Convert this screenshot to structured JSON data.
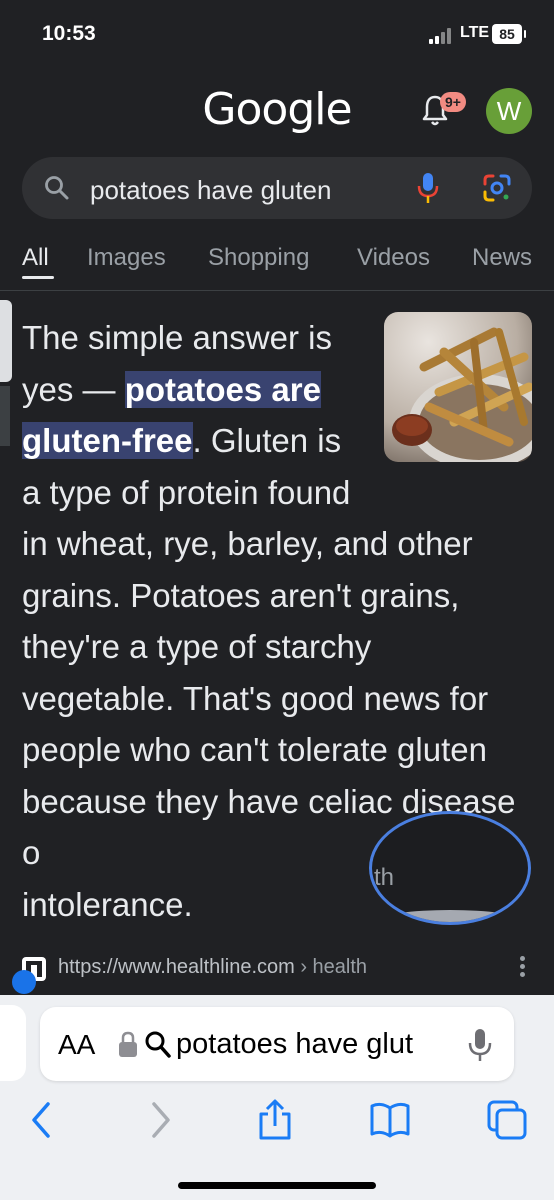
{
  "status_bar": {
    "time": "10:53",
    "network": "LTE",
    "battery": "85"
  },
  "header": {
    "logo": "Google",
    "notifications_badge": "9+",
    "avatar_initial": "W"
  },
  "search": {
    "query": "potatoes have gluten"
  },
  "tabs": [
    {
      "label": "All",
      "active": true
    },
    {
      "label": "Images",
      "active": false
    },
    {
      "label": "Shopping",
      "active": false
    },
    {
      "label": "Videos",
      "active": false
    },
    {
      "label": "News",
      "active": false
    }
  ],
  "answer": {
    "pre": "The simple answer is yes — ",
    "highlight": "potatoes are gluten-free",
    "post": ". Gluten is a type of protein found in wheat, rye, barley, and other grains. Potatoes aren't grains, they're a type of starchy vegetable. That's good news for people who can't tolerate gluten because they have celiac disease o",
    "end": "intolerance.",
    "ring_fragment": "th"
  },
  "source": {
    "url": "https://www.healthline.com",
    "path": "› health"
  },
  "safari": {
    "aa": "AA",
    "address_text": "potatoes have glut"
  },
  "colors": {
    "highlight": "#394370",
    "accent": "#1a73e8",
    "safari_blue": "#1a7cf5"
  }
}
